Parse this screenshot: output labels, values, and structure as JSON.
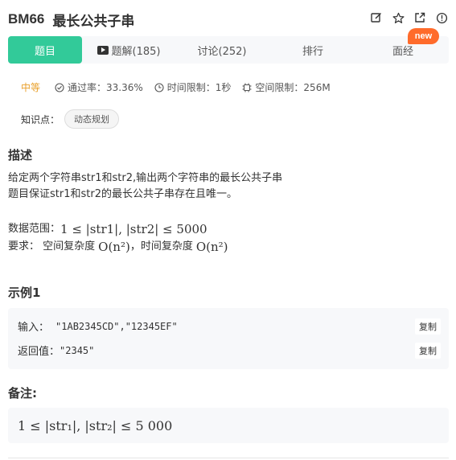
{
  "problem": {
    "id": "BM66",
    "name": "最长公共子串"
  },
  "header_icons": [
    "edit-icon",
    "star-icon",
    "share-icon",
    "info-icon"
  ],
  "badge": "new",
  "tabs": [
    {
      "label": "题目",
      "active": true
    },
    {
      "label": "题解(185)",
      "icon": "video-icon"
    },
    {
      "label": "讨论(252)"
    },
    {
      "label": "排行"
    },
    {
      "label": "面经"
    }
  ],
  "meta": {
    "difficulty": "中等",
    "pass_rate": "通过率：33.36%",
    "time_limit": "时间限制：1秒",
    "space_limit": "空间限制：256M"
  },
  "knowledge": {
    "label": "知识点：",
    "tag": "动态规划"
  },
  "description": {
    "title": "描述",
    "line1": "给定两个字符串str1和str2,输出两个字符串的最长公共子串",
    "line2": "题目保证str1和str2的最长公共子串存在且唯一。",
    "range_label": "数据范围：",
    "range_math": "1 ≤ |str1|, |str2| ≤ 5000",
    "req_label": "要求：  空间复杂度",
    "req_space": "O(n²)",
    "req_mid": "，时间复杂度",
    "req_time": "O(n²)"
  },
  "example": {
    "title": "示例1",
    "input_label": "输入：",
    "input_value": "\"1AB2345CD\",\"12345EF\"",
    "output_label": "返回值：",
    "output_value": "\"2345\"",
    "copy_label": "复制"
  },
  "note": {
    "title": "备注:",
    "math": "1 ≤ |str₁|, |str₂| ≤ 5 000"
  },
  "colors": {
    "accent": "#32ca99",
    "difficulty": "#e9a02b",
    "badge": "#ff6b2b"
  }
}
